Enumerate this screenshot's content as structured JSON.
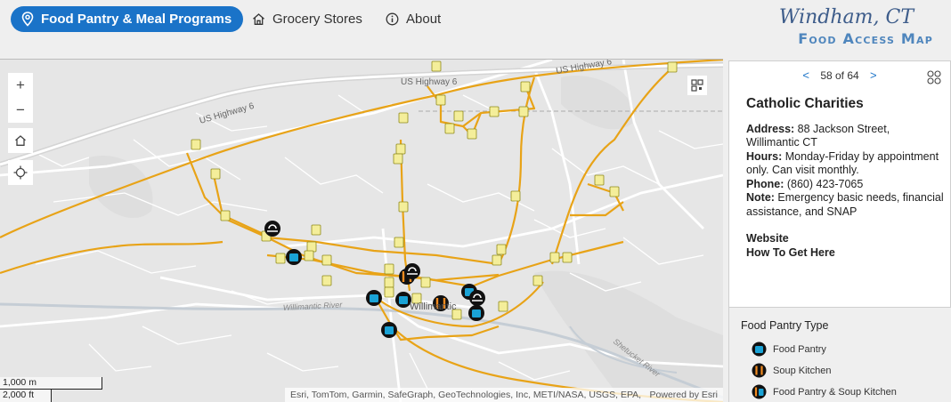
{
  "header": {
    "tabs": [
      {
        "label": "Food Pantry & Meal Programs",
        "icon": "map-pin-icon",
        "active": true
      },
      {
        "label": "Grocery Stores",
        "icon": "home-icon",
        "active": false
      },
      {
        "label": "About",
        "icon": "info-icon",
        "active": false
      }
    ],
    "brand_town": "Windham, CT",
    "brand_subtitle": "Food Access Map"
  },
  "map": {
    "labels": {
      "us6_a": "US Highway 6",
      "us6_b": "US Highway 6",
      "us6_c": "US Highway 6",
      "willimantic": "Willimantic",
      "willimantic_river": "Willimantic River",
      "shetucket_river": "Shetucket River"
    },
    "attribution": "Esri, TomTom, Garmin, SafeGraph, GeoTechnologies, Inc, METI/NASA, USGS, EPA, N…",
    "powered_by": "Powered by Esri",
    "scale_metric": "1,000 m",
    "scale_imperial": "2,000 ft",
    "controls": {
      "zoom_in": "+",
      "zoom_out": "−"
    }
  },
  "info": {
    "pager": "58 of 64",
    "prev": "<",
    "next": ">",
    "site_name": "Catholic Charities",
    "address_label": "Address:",
    "address": " 88 Jackson Street, Willimantic CT",
    "hours_label": "Hours:",
    "hours": " Monday-Friday by appointment only. Can visit monthly.",
    "phone_label": "Phone:",
    "phone": " (860) 423-7065",
    "note_label": "Note:",
    "note": " Emergency basic needs, financial assistance, and SNAP",
    "website": "Website",
    "directions": "How To Get Here"
  },
  "legend": {
    "title": "Food Pantry Type",
    "items": [
      {
        "label": "Food Pantry",
        "icon": "food-pantry-icon"
      },
      {
        "label": "Soup Kitchen",
        "icon": "soup-kitchen-icon"
      },
      {
        "label": "Food Pantry & Soup Kitchen",
        "icon": "pantry-and-kitchen-icon"
      }
    ]
  },
  "colors": {
    "accent": "#1a73c8",
    "bus_route": "#e8a317",
    "pantry_marker": "#1aa3d6",
    "kitchen_marker": "#f28b20",
    "bus_stop": "#f4ee9a"
  }
}
